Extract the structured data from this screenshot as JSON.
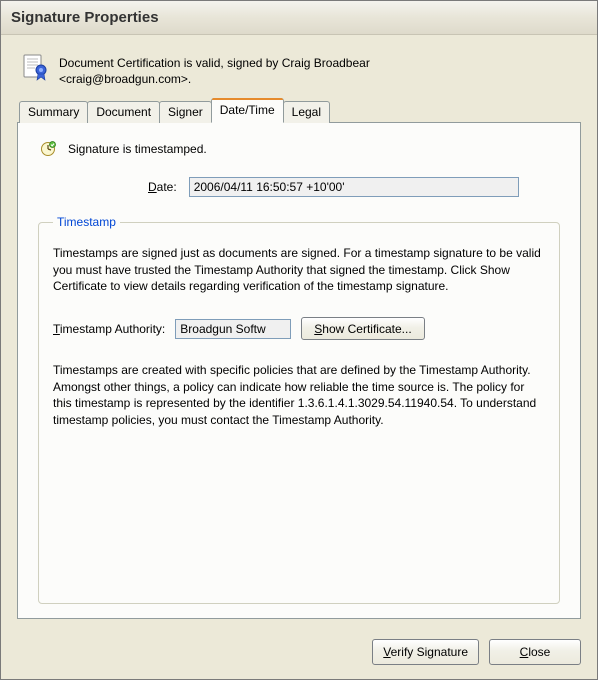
{
  "window": {
    "title": "Signature Properties"
  },
  "certification": {
    "line1": "Document Certification is valid, signed by Craig Broadbear",
    "line2": "<craig@broadgun.com>."
  },
  "tabs": {
    "items": [
      {
        "label": "Summary"
      },
      {
        "label": "Document"
      },
      {
        "label": "Signer"
      },
      {
        "label": "Date/Time"
      },
      {
        "label": "Legal"
      }
    ],
    "active_index": 3
  },
  "panel": {
    "status": "Signature is timestamped.",
    "date_label": "Date:",
    "date_value": "2006/04/11 16:50:57 +10'00'",
    "group_legend": "Timestamp",
    "para1": "Timestamps are signed just as documents are signed. For a timestamp signature to be valid you must have trusted the Timestamp Authority that signed the timestamp. Click Show Certificate to view details regarding verification of the timestamp signature.",
    "authority_label": "Timestamp Authority:",
    "authority_value": "Broadgun Softw",
    "show_cert_label": "Show Certificate...",
    "para2": "Timestamps are created with specific policies that are defined by the Timestamp Authority. Amongst other things, a policy can indicate how reliable the time source is. The policy for this timestamp is represented by the identifier 1.3.6.1.4.1.3029.54.11940.54. To understand timestamp policies, you must contact the Timestamp Authority."
  },
  "footer": {
    "verify_label": "Verify Signature",
    "close_label": "Close"
  }
}
